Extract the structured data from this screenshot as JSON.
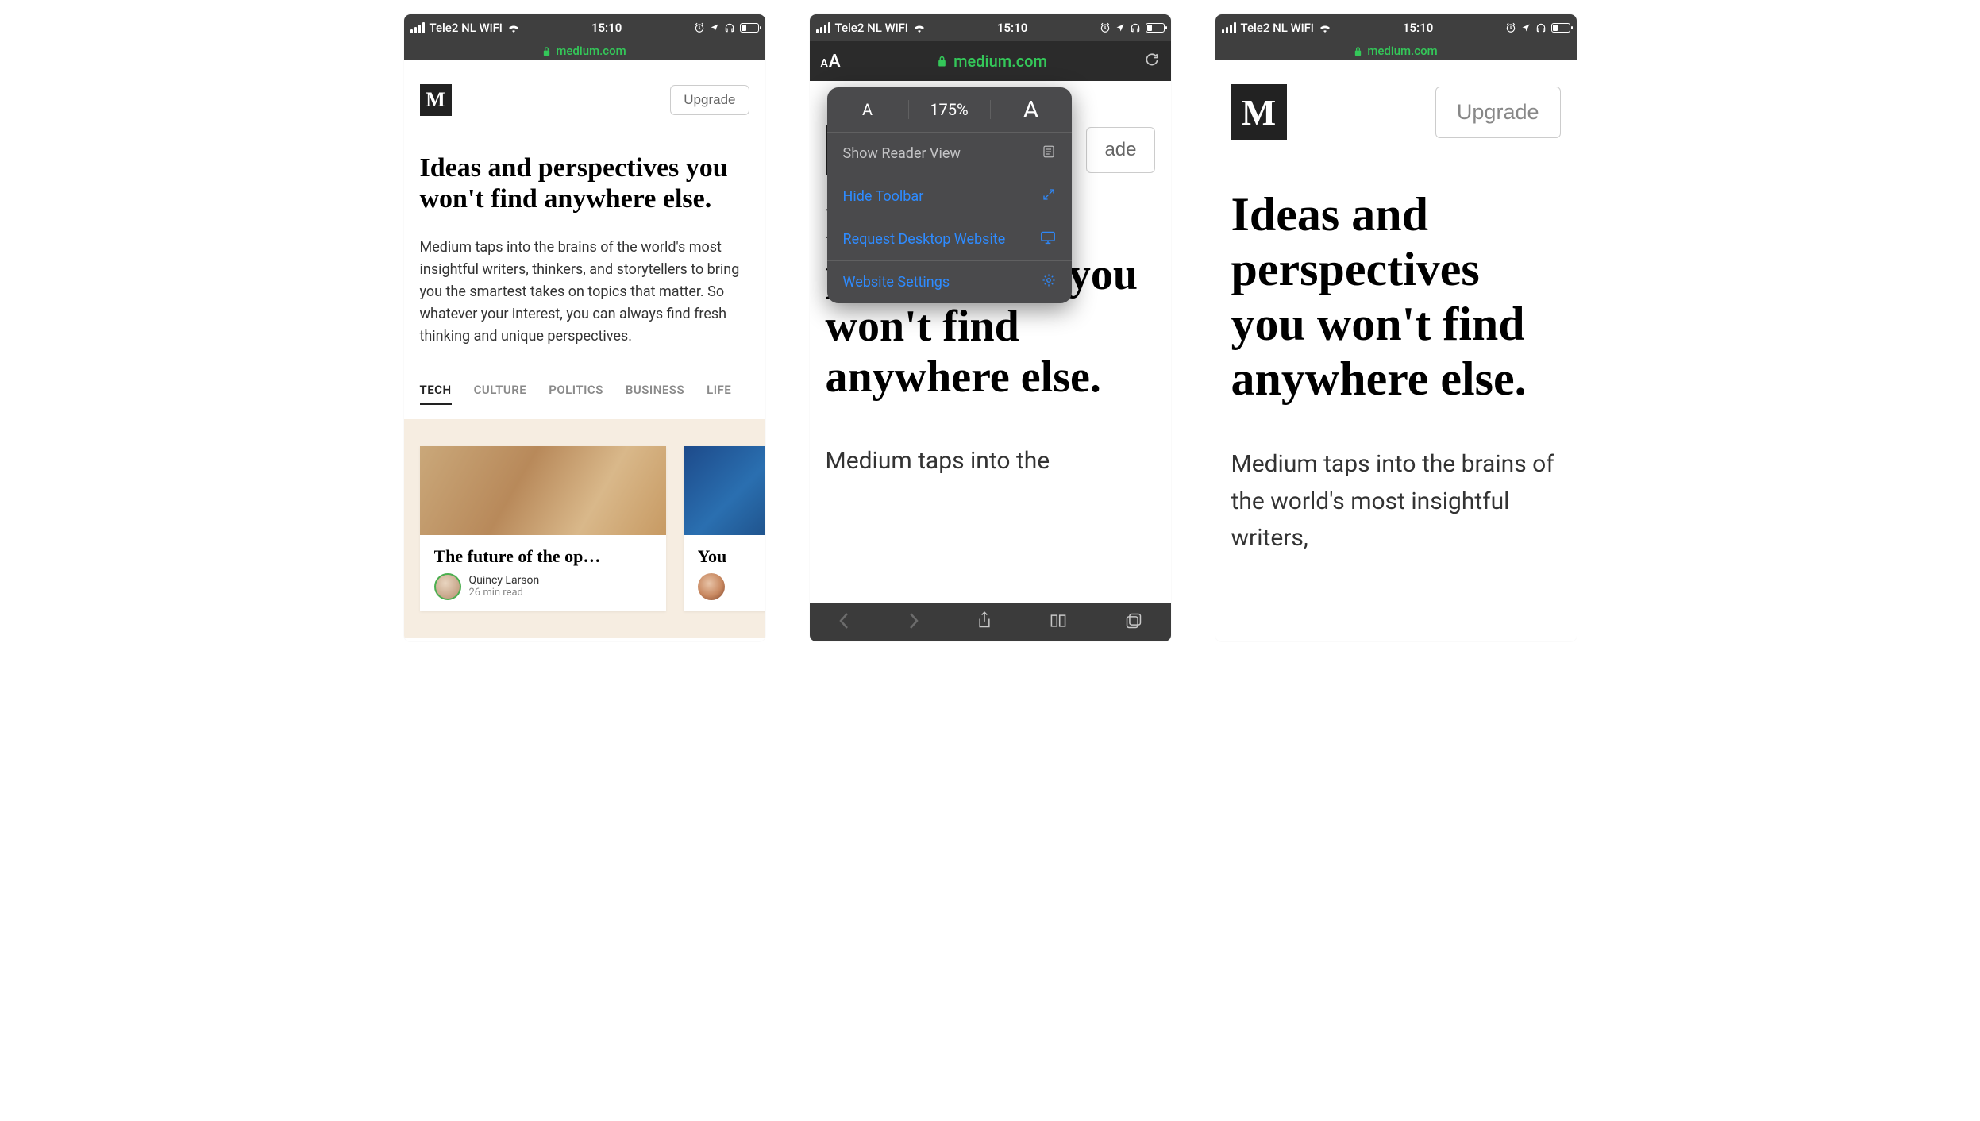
{
  "status": {
    "carrier": "Tele2 NL WiFi",
    "time": "15:10"
  },
  "url": {
    "domain": "medium.com"
  },
  "medium": {
    "upgrade": "Upgrade",
    "headline": "Ideas and perspectives you won't find anywhere else.",
    "sub_full": "Medium taps into the brains of the world's most insightful writers, thinkers, and storytellers to bring you the smartest takes on topics that matter. So whatever your interest, you can always find fresh thinking and unique perspectives.",
    "sub_trim2": "Medium taps into the",
    "sub_trim3": "Medium taps into the brains of the world's most insightful writers,"
  },
  "tabs": [
    {
      "label": "TECH",
      "active": true
    },
    {
      "label": "CULTURE",
      "active": false
    },
    {
      "label": "POLITICS",
      "active": false
    },
    {
      "label": "BUSINESS",
      "active": false
    },
    {
      "label": "LIFE",
      "active": false
    }
  ],
  "cards": [
    {
      "title": "The future of the op…",
      "author": "Quincy Larson",
      "read": "26 min read"
    },
    {
      "title": "You",
      "author": "",
      "read": ""
    }
  ],
  "popover": {
    "zoom_level": "175%",
    "show_reader": "Show Reader View",
    "hide_toolbar": "Hide Toolbar",
    "request_desktop": "Request Desktop Website",
    "website_settings": "Website Settings"
  }
}
